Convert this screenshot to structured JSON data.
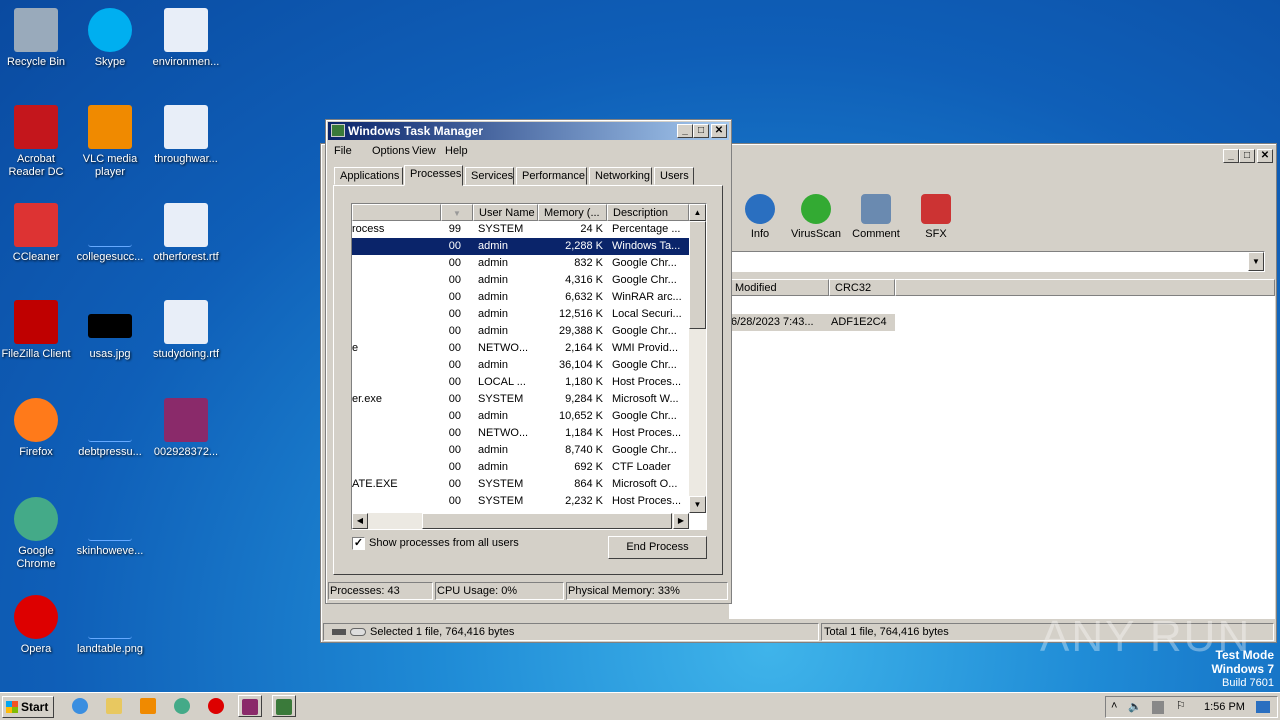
{
  "desktop_icons": [
    {
      "label": "Recycle Bin",
      "icon": "recycle-bin-icon"
    },
    {
      "label": "Skype",
      "icon": "skype-icon"
    },
    {
      "label": "environmen...",
      "icon": "word-document-icon"
    },
    {
      "label": "Acrobat Reader DC",
      "icon": "acrobat-icon"
    },
    {
      "label": "VLC media player",
      "icon": "vlc-icon"
    },
    {
      "label": "throughwar...",
      "icon": "word-document-icon"
    },
    {
      "label": "CCleaner",
      "icon": "ccleaner-icon"
    },
    {
      "label": "collegesucc...",
      "icon": "blank-file-icon"
    },
    {
      "label": "otherforest.rtf",
      "icon": "word-document-icon"
    },
    {
      "label": "FileZilla Client",
      "icon": "filezilla-icon"
    },
    {
      "label": "usas.jpg",
      "icon": "image-file-icon"
    },
    {
      "label": "studydoing.rtf",
      "icon": "word-document-icon"
    },
    {
      "label": "Firefox",
      "icon": "firefox-icon"
    },
    {
      "label": "debtpressu...",
      "icon": "blank-file-icon"
    },
    {
      "label": "002928372...",
      "icon": "winrar-archive-icon"
    },
    {
      "label": "Google Chrome",
      "icon": "chrome-icon"
    },
    {
      "label": "skinhoweve...",
      "icon": "blank-file-icon"
    },
    {
      "label": "Opera",
      "icon": "opera-icon"
    },
    {
      "label": "landtable.png",
      "icon": "blank-file-icon"
    }
  ],
  "winrar": {
    "toolbar": [
      {
        "label": "Info"
      },
      {
        "label": "VirusScan"
      },
      {
        "label": "Comment"
      },
      {
        "label": "SFX"
      }
    ],
    "columns": [
      "Modified",
      "CRC32"
    ],
    "row": {
      "modified": "6/28/2023 7:43...",
      "crc": "ADF1E2C4"
    },
    "status_left": "Selected 1 file, 764,416 bytes",
    "status_right": "Total 1 file, 764,416 bytes"
  },
  "taskmgr": {
    "title": "Windows Task Manager",
    "menu": [
      "File",
      "Options",
      "View",
      "Help"
    ],
    "tabs": [
      "Applications",
      "Processes",
      "Services",
      "Performance",
      "Networking",
      "Users"
    ],
    "active_tab": "Processes",
    "columns": [
      "",
      "",
      "User Name",
      "Memory (...",
      "Description"
    ],
    "rows": [
      [
        "rocess",
        "99",
        "SYSTEM",
        "24 K",
        "Percentage ..."
      ],
      [
        "",
        "00",
        "admin",
        "2,288 K",
        "Windows Ta..."
      ],
      [
        "",
        "00",
        "admin",
        "832 K",
        "Google Chr..."
      ],
      [
        "",
        "00",
        "admin",
        "4,316 K",
        "Google Chr..."
      ],
      [
        "",
        "00",
        "admin",
        "6,632 K",
        "WinRAR arc..."
      ],
      [
        "",
        "00",
        "admin",
        "12,516 K",
        "Local Securi..."
      ],
      [
        "",
        "00",
        "admin",
        "29,388 K",
        "Google Chr..."
      ],
      [
        "e",
        "00",
        "NETWO...",
        "2,164 K",
        "WMI Provid..."
      ],
      [
        "",
        "00",
        "admin",
        "36,104 K",
        "Google Chr..."
      ],
      [
        "",
        "00",
        "LOCAL ...",
        "1,180 K",
        "Host Proces..."
      ],
      [
        "er.exe",
        "00",
        "SYSTEM",
        "9,284 K",
        "Microsoft W..."
      ],
      [
        "",
        "00",
        "admin",
        "10,652 K",
        "Google Chr..."
      ],
      [
        "",
        "00",
        "NETWO...",
        "1,184 K",
        "Host Proces..."
      ],
      [
        "",
        "00",
        "admin",
        "8,740 K",
        "Google Chr..."
      ],
      [
        "",
        "00",
        "admin",
        "692 K",
        "CTF Loader"
      ],
      [
        "ATE.EXE",
        "00",
        "SYSTEM",
        "864 K",
        "Microsoft O..."
      ],
      [
        "",
        "00",
        "SYSTEM",
        "2,232 K",
        "Host Proces..."
      ]
    ],
    "selected_row": 1,
    "show_all_label": "Show processes from all users",
    "show_all_checked": true,
    "end_process": "End Process",
    "status": {
      "processes": "Processes: 43",
      "cpu": "CPU Usage: 0%",
      "memory": "Physical Memory: 33%"
    }
  },
  "taskbar": {
    "start": "Start",
    "clock": "1:56 PM"
  },
  "watermark": {
    "brand": "ANY RUN",
    "line1": "Test Mode",
    "line2": "Windows 7",
    "line3": "Build 7601"
  }
}
